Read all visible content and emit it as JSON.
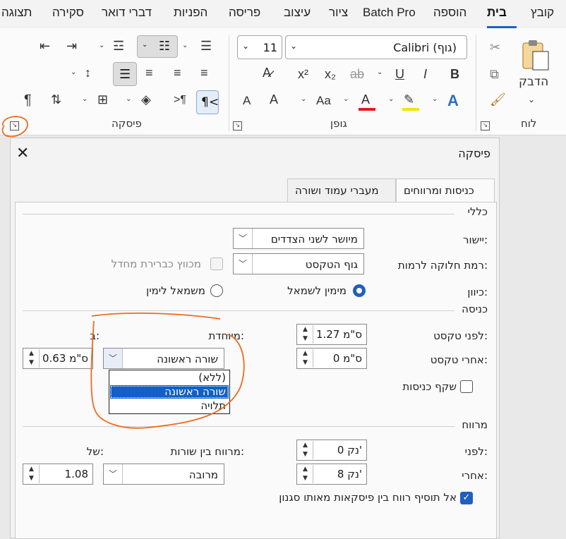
{
  "tabs": [
    "קובץ",
    "בית",
    "הוספה",
    "Batch Pro",
    "ציור",
    "עיצוב",
    "פריסה",
    "הפניות",
    "דברי דואר",
    "סקירה",
    "תצוגה"
  ],
  "ribbon": {
    "paste_label": "הדבק",
    "clipboard_label": "לוח",
    "font_label": "גופן",
    "paragraph_label": "פיסקה",
    "font_name": "Calibri (גוף)",
    "font_size": "11",
    "bold": "B",
    "italic": "I",
    "underline": "U",
    "strike": "ab",
    "subscript": "x₂",
    "superscript": "x²",
    "change_case": "Aa",
    "font_color": "A",
    "grow": "A",
    "shrink": "A",
    "pilcrow": "¶"
  },
  "dialog": {
    "title": "פיסקה",
    "tabs": [
      "כניסות ומרווחים",
      "מעברי עמוד ושורה"
    ],
    "general": {
      "section": "כללי",
      "alignment_label": "יישור:",
      "alignment_value": "מיושר לשני הצדדים",
      "outline_label": "רמת חלוקה לרמות:",
      "outline_value": "גוף הטקסט",
      "collapsed_label": "מכווץ כברירת מחדל",
      "direction_label": "כיוון:",
      "rtl_label": "מימין לשמאל",
      "ltr_label": "משמאל לימין"
    },
    "indent": {
      "section": "כניסה",
      "before_label": "לפני טקסט:",
      "before_value": "1.27 ס\"מ",
      "after_label": "אחרי טקסט:",
      "after_value": "0 ס\"מ",
      "special_label": "מיוחדת:",
      "special_value": "שורה ראשונה",
      "by_label": "ב:",
      "by_value": "0.63 ס\"מ",
      "mirror_label": "שקף כניסות",
      "options": [
        "(ללא)",
        "שורה ראשונה",
        "תלויה"
      ]
    },
    "spacing": {
      "section": "מרווח",
      "before_label": "לפני:",
      "before_value": "0 נק'",
      "after_label": "אחרי:",
      "after_value": "8 נק'",
      "line_label": "מרווח בין שורות:",
      "line_value": "מרובה",
      "at_label": "של:",
      "at_value": "1.08",
      "dont_add_label": "אל תוסיף רווח בין פיסקאות מאותו סגנון"
    }
  },
  "colors": {
    "accent": "#1f5fbf",
    "annotation": "#f06a1e"
  }
}
